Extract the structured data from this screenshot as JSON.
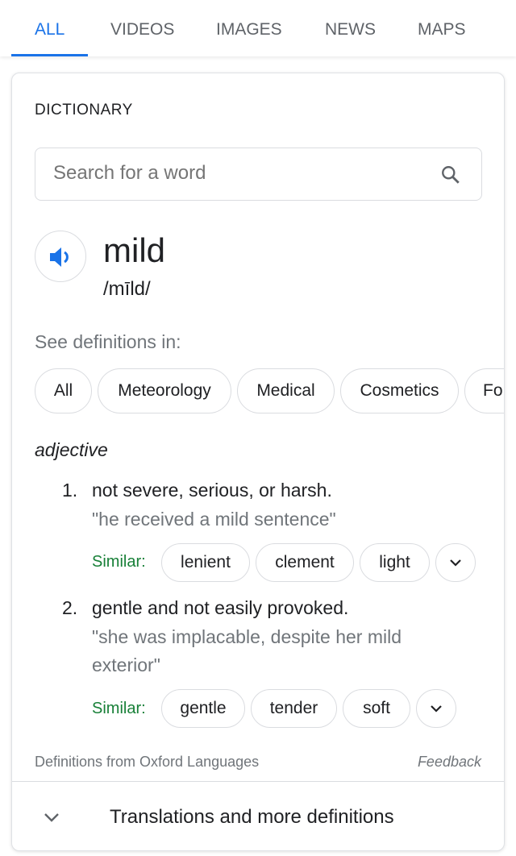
{
  "tabs": [
    {
      "label": "ALL",
      "active": true
    },
    {
      "label": "VIDEOS"
    },
    {
      "label": "IMAGES"
    },
    {
      "label": "NEWS"
    },
    {
      "label": "MAPS"
    }
  ],
  "dictionary": {
    "heading": "DICTIONARY",
    "search_placeholder": "Search for a word",
    "word": "mild",
    "pronunciation": "/mīld/",
    "see_definitions": "See definitions in:",
    "categories": [
      "All",
      "Meteorology",
      "Medical",
      "Cosmetics",
      "Fo"
    ],
    "part_of_speech": "adjective",
    "definitions": [
      {
        "number": "1.",
        "text": "not severe, serious, or harsh.",
        "example": "\"he received a mild sentence\"",
        "similar_label": "Similar:",
        "similar": [
          "lenient",
          "clement",
          "light"
        ]
      },
      {
        "number": "2.",
        "text": "gentle and not easily provoked.",
        "example_line1": "\"she was implacable, despite her mild",
        "example_line2": "exterior\"",
        "similar_label": "Similar:",
        "similar": [
          "gentle",
          "tender",
          "soft"
        ]
      }
    ],
    "source": "Definitions from Oxford Languages",
    "feedback": "Feedback",
    "more": "Translations and more definitions"
  },
  "colors": {
    "accent": "#1a73e8",
    "similar": "#188038"
  }
}
